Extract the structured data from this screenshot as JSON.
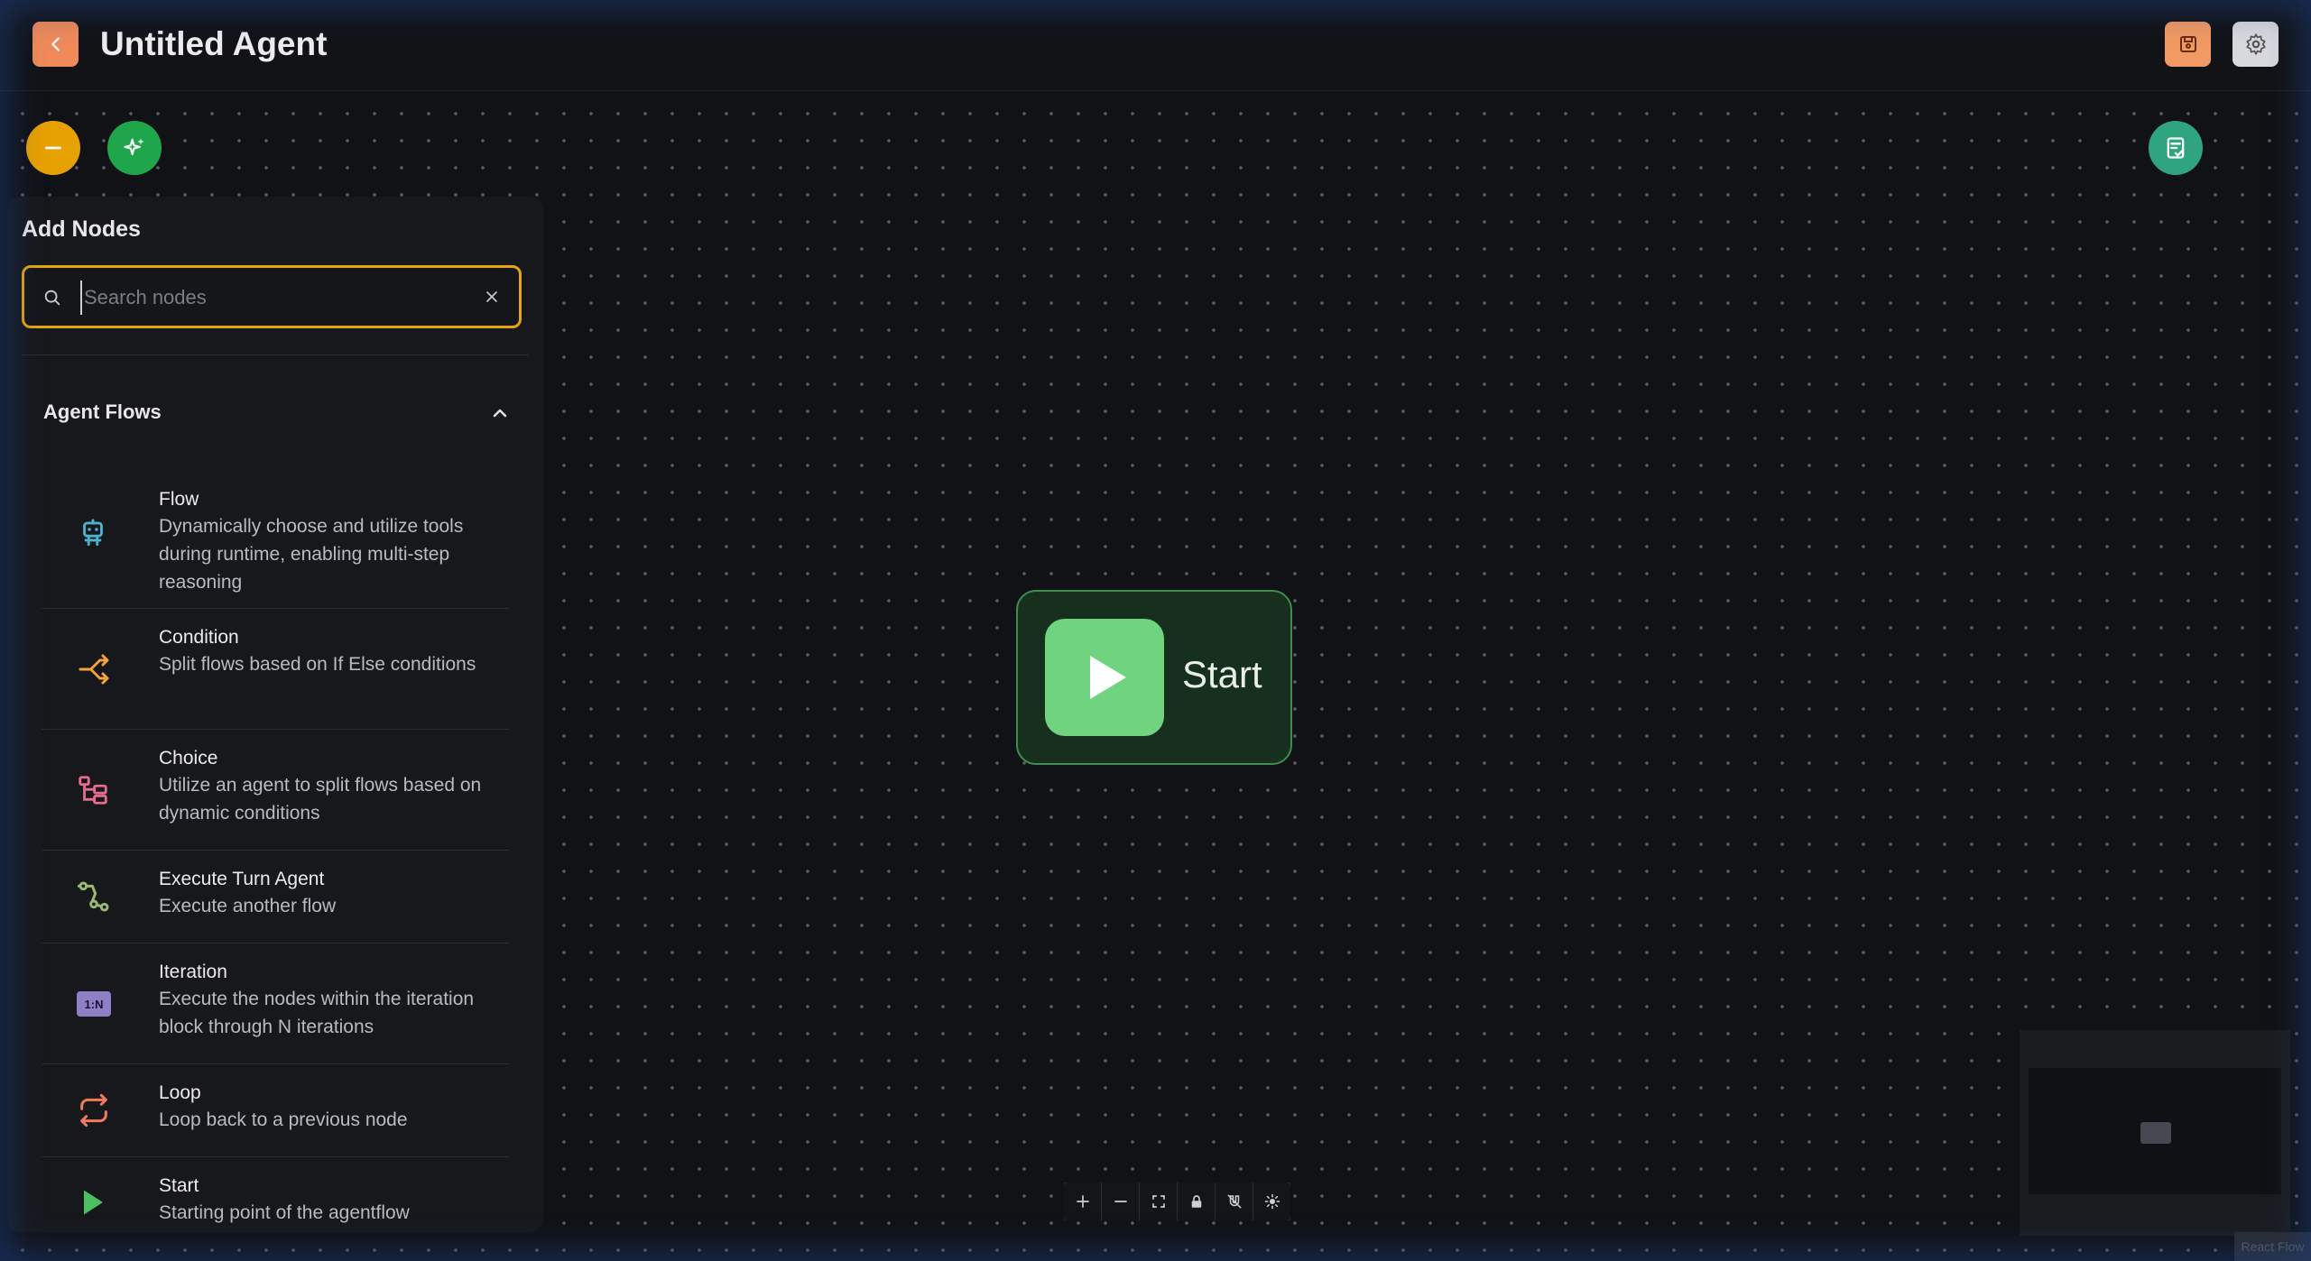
{
  "header": {
    "title": "Untitled Agent"
  },
  "panel": {
    "title": "Add Nodes",
    "search": {
      "placeholder": "Search nodes",
      "value": ""
    },
    "section": {
      "label": "Agent Flows",
      "items": [
        {
          "name": "Flow",
          "desc": "Dynamically choose and utilize tools during runtime, enabling multi-step reasoning",
          "icon": "robot-icon",
          "color": "#4bb3cf"
        },
        {
          "name": "Condition",
          "desc": "Split flows based on If Else conditions",
          "icon": "split-icon",
          "color": "#f2a33a"
        },
        {
          "name": "Choice",
          "desc": "Utilize an agent to split flows based on dynamic conditions",
          "icon": "tree-icon",
          "color": "#e76b8a"
        },
        {
          "name": "Execute Turn Agent",
          "desc": "Execute another flow",
          "icon": "route-icon",
          "color": "#9ab870"
        },
        {
          "name": "Iteration",
          "desc": "Execute the nodes within the iteration block through N iterations",
          "icon": "iteration-icon",
          "color": "#8e7fc6"
        },
        {
          "name": "Loop",
          "desc": "Loop back to a previous node",
          "icon": "loop-icon",
          "color": "#ef7a5c"
        },
        {
          "name": "Start",
          "desc": "Starting point of the agentflow",
          "icon": "play-icon",
          "color": "#4cc060"
        }
      ]
    }
  },
  "canvas": {
    "start_node_label": "Start"
  },
  "attribution": "React Flow"
}
